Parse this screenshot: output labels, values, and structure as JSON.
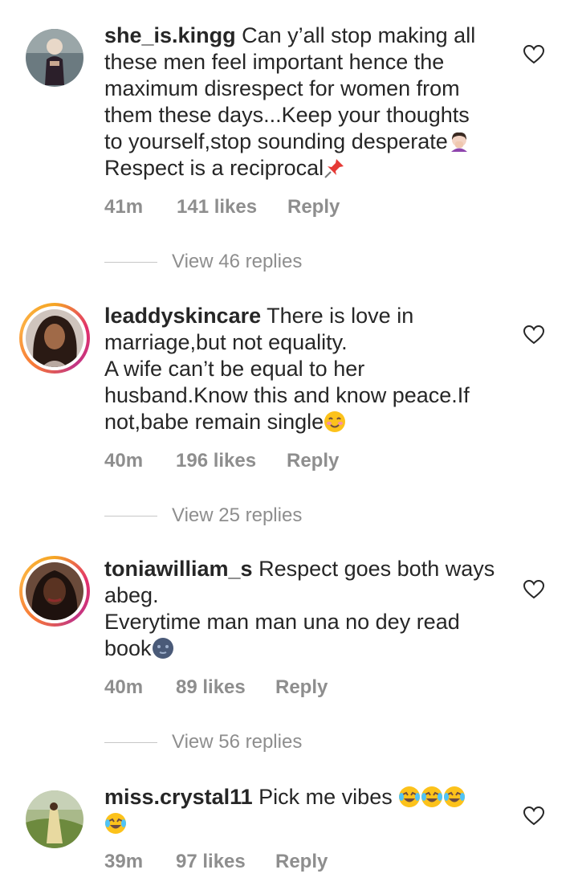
{
  "comments": [
    {
      "username": "she_is.kingg",
      "text": " Can y’all stop making all\nthese men feel important hence the\nmaximum disrespect for women from\nthem these days...Keep your thoughts\nto yourself,stop sounding desperate",
      "text2": "\nRespect is a reciprocal",
      "time": "41m",
      "likes": "141 likes",
      "reply": "Reply",
      "view_replies": "View 46 replies"
    },
    {
      "username": "leaddyskincare",
      "text": " There is love in\nmarriage,but not equality.\nA wife can’t be equal to her\nhusband.Know this and know peace.If\nnot,babe remain single",
      "time": "40m",
      "likes": "196 likes",
      "reply": "Reply",
      "view_replies": "View 25 replies"
    },
    {
      "username": "toniawilliam_s",
      "text": " Respect goes both ways\nabeg.\nEverytime man man una no dey read\nbook",
      "time": "40m",
      "likes": "89 likes",
      "reply": "Reply",
      "view_replies": "View 56 replies"
    },
    {
      "username": "miss.crystal11",
      "text": " Pick me vibes ",
      "time": "39m",
      "likes": "97 likes",
      "reply": "Reply"
    }
  ],
  "icons": {
    "like": "heart-outline-icon",
    "emoji_facepalm": "woman-facepalming-emoji",
    "emoji_pin": "pushpin-emoji",
    "emoji_smile": "smiling-face-emoji",
    "emoji_moon": "new-moon-face-emoji",
    "emoji_laugh": "tears-of-joy-emoji"
  },
  "colors": {
    "text": "#262626",
    "secondary": "#8e8e8e",
    "story_ring": "#e1306c"
  }
}
